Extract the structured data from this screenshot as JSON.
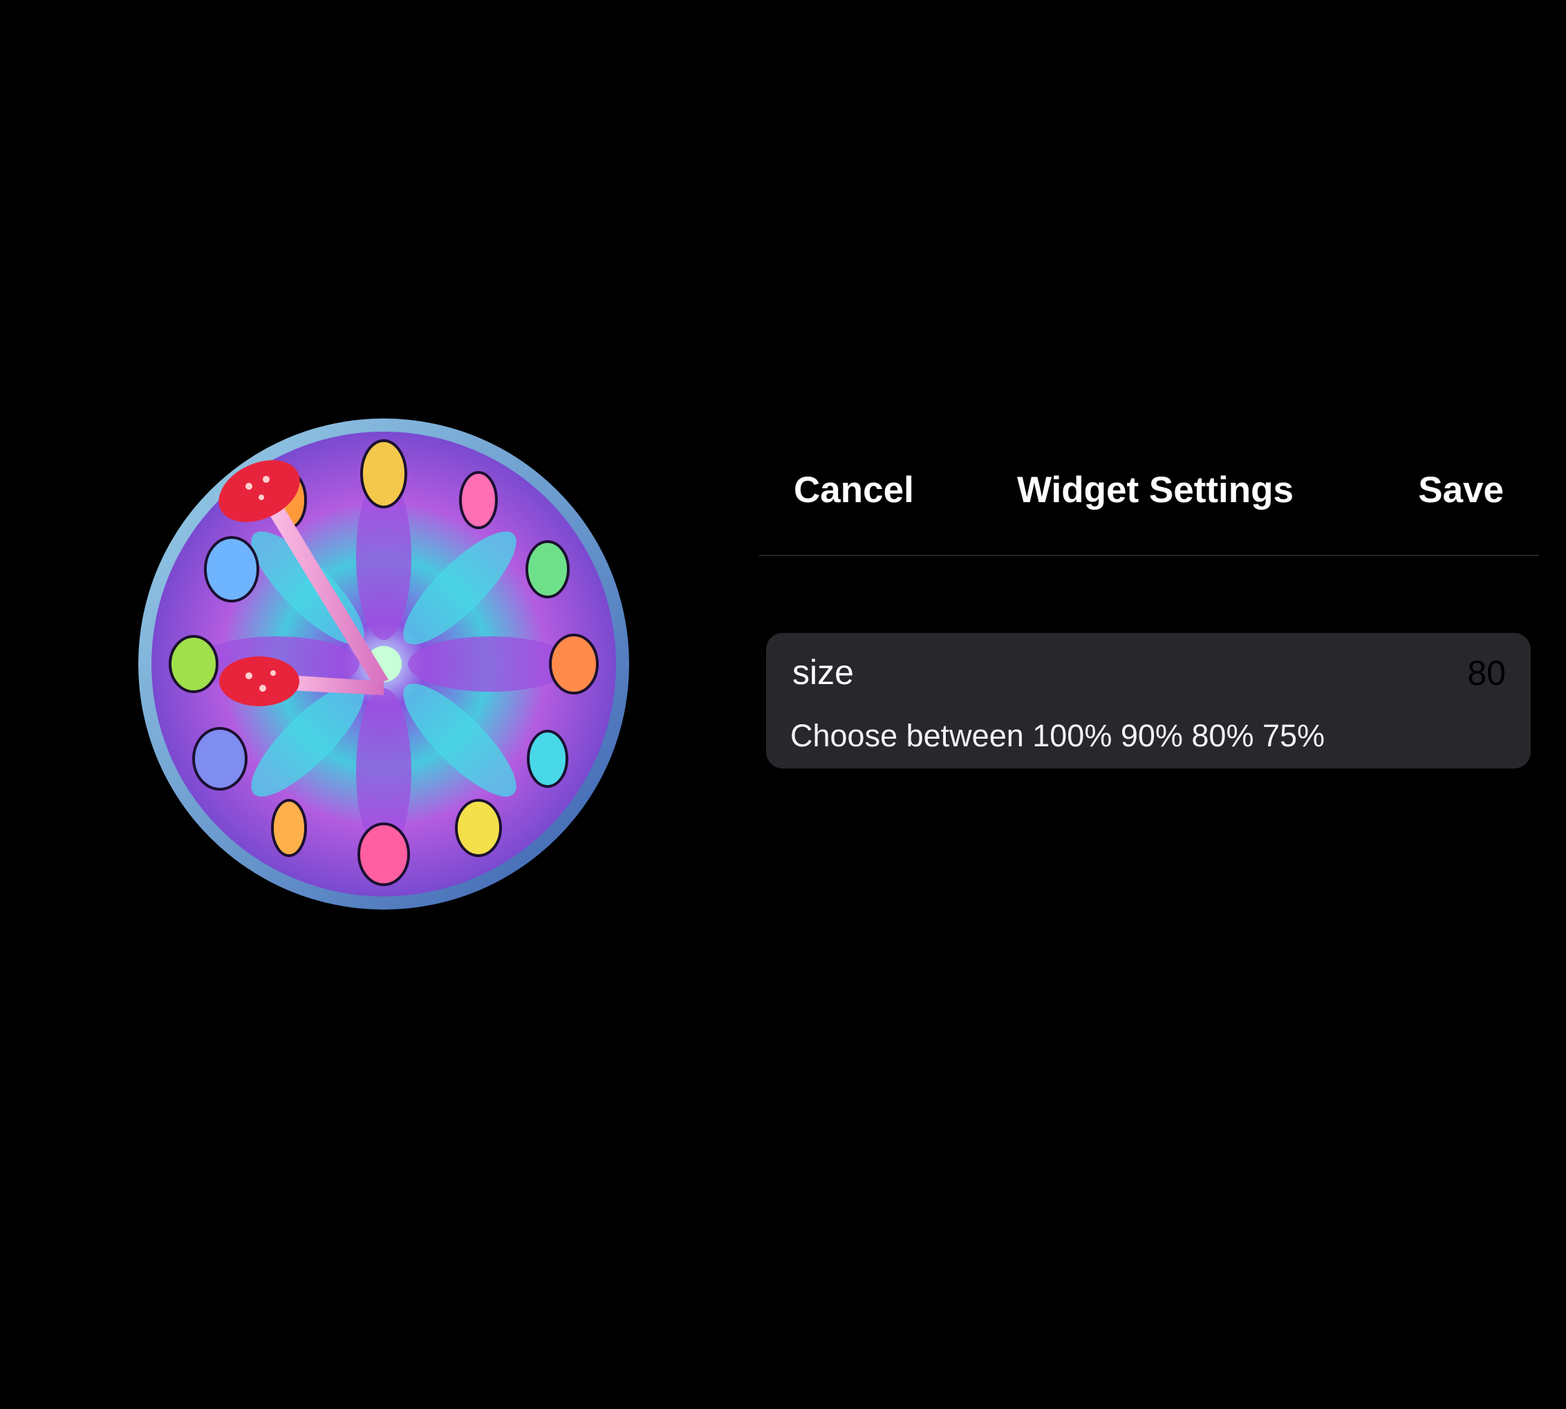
{
  "widget_preview": {
    "name": "psychedelic-clock-face",
    "colors": {
      "rim": "#6c9ccf",
      "dial_base": "#6a3fbf",
      "accent_pink": "#ff5fb0",
      "accent_cyan": "#49d8e8",
      "mushroom_cap": "#e8243c"
    }
  },
  "nav": {
    "cancel_label": "Cancel",
    "title": "Widget Settings",
    "save_label": "Save"
  },
  "settings": {
    "size": {
      "label": "size",
      "value": "80",
      "hint": "Choose between 100% 90% 80% 75%"
    }
  },
  "colors": {
    "background": "#000000",
    "card": "#28272c",
    "divider": "#262629",
    "text": "#ffffff"
  }
}
